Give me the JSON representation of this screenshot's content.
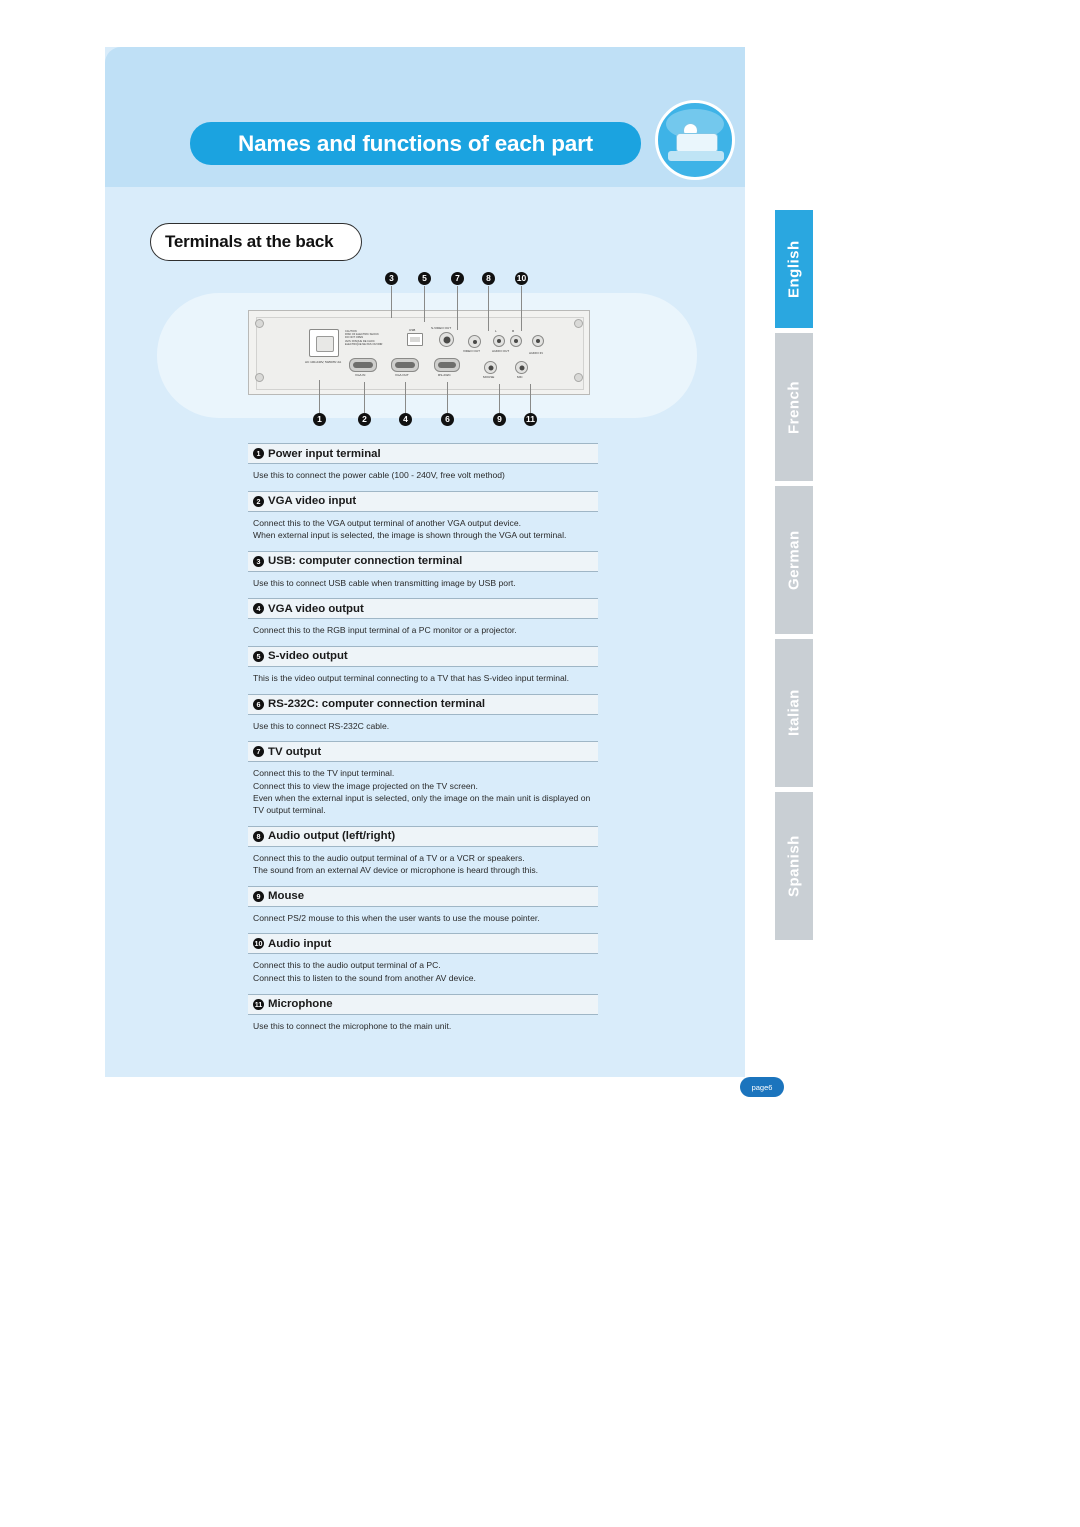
{
  "header": {
    "title": "Names and functions of each part",
    "icon": "projector-icon"
  },
  "section": {
    "tab_label": "Terminals at the back"
  },
  "diagram": {
    "callouts_top": [
      "3",
      "5",
      "7",
      "8",
      "10"
    ],
    "callouts_bottom": [
      "1",
      "2",
      "4",
      "6",
      "9",
      "11"
    ],
    "panel_labels": {
      "caution": "CAUTION\nRISK OF ELECTRIC SHOCK\nDO NOT OPEN\nAVIS : RISQUE DE CHOC ELECTRIQUE NE PAS OUVRIR",
      "usb": "USB",
      "svideo_out": "S-VIDEO OUT",
      "video_out": "VIDEO OUT",
      "audio_out": "AUDIO OUT",
      "audio_out_l": "L",
      "audio_out_r": "R",
      "audio_in": "AUDIO IN",
      "power": "AC 100-240V, 50/60Hz 2A",
      "vga_in": "VGA IN",
      "vga_out": "VGA OUT",
      "rs232c": "RS-232C",
      "mouse": "MOUSE",
      "mic": "MIC"
    }
  },
  "items": [
    {
      "num": "1",
      "title": "Power input terminal",
      "lines": [
        "Use this to connect the power cable (100 - 240V, free volt method)"
      ]
    },
    {
      "num": "2",
      "title": "VGA video input",
      "lines": [
        "Connect this to the VGA output terminal of another VGA output device.",
        "When external input is selected, the image is shown through the VGA out terminal."
      ]
    },
    {
      "num": "3",
      "title": "USB: computer connection terminal",
      "lines": [
        "Use this to connect USB cable when transmitting image by USB port."
      ]
    },
    {
      "num": "4",
      "title": "VGA video output",
      "lines": [
        "Connect this to the RGB input terminal of a PC monitor or a projector."
      ]
    },
    {
      "num": "5",
      "title": "S-video output",
      "lines": [
        "This is the video output terminal connecting to a TV that has S-video input terminal."
      ]
    },
    {
      "num": "6",
      "title": "RS-232C: computer connection terminal",
      "lines": [
        "Use this to connect RS-232C cable."
      ]
    },
    {
      "num": "7",
      "title": "TV output",
      "lines": [
        "Connect this to the TV input terminal.",
        "Connect this to view the image projected on the TV screen.",
        "Even when the external input is selected, only the image on the main unit is displayed on TV output terminal."
      ]
    },
    {
      "num": "8",
      "title": "Audio output (left/right)",
      "lines": [
        "Connect this to the audio output terminal of a TV or a VCR or speakers.",
        "The sound from an external AV device or microphone is heard through this."
      ]
    },
    {
      "num": "9",
      "title": "Mouse",
      "lines": [
        "Connect PS/2 mouse to this when the user wants to use the mouse pointer."
      ]
    },
    {
      "num": "10",
      "title": "Audio input",
      "lines": [
        "Connect this to the audio output terminal of a PC.",
        "Connect this to listen to the sound from another AV device."
      ]
    },
    {
      "num": "11",
      "title": "Microphone",
      "lines": [
        "Use this to connect the microphone to the main unit."
      ]
    }
  ],
  "languages": [
    {
      "label": "English",
      "active": true
    },
    {
      "label": "French",
      "active": false
    },
    {
      "label": "German",
      "active": false
    },
    {
      "label": "Italian",
      "active": false
    },
    {
      "label": "Spanish",
      "active": false
    }
  ],
  "footer": {
    "page_label": "page6"
  },
  "colors": {
    "accent": "#1ba3e0",
    "panel": "#d9ecfa",
    "panel_top": "#bfe0f6",
    "tab_active": "#2aa7e0",
    "tab_inactive": "#c9cfd4",
    "badge": "#1b74bd"
  }
}
